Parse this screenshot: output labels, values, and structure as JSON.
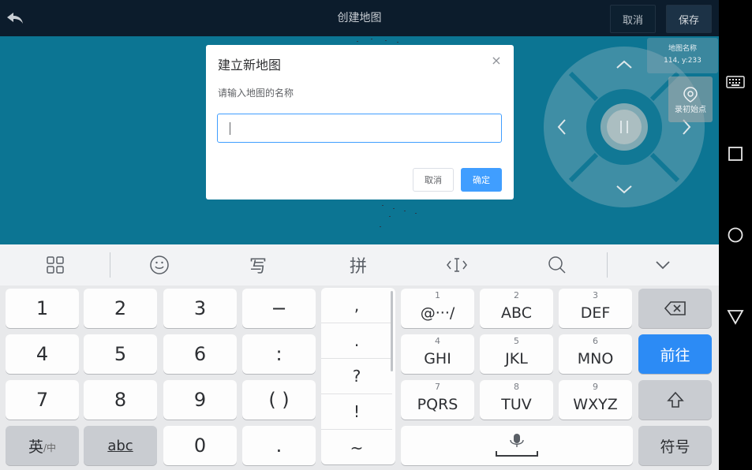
{
  "header": {
    "title": "创建地图",
    "cancel_label": "取消",
    "save_label": "保存"
  },
  "overlay": {
    "info_line1": "地图名称",
    "info_line2": "114, y:233",
    "record_label": "录初始点"
  },
  "dialog": {
    "title": "建立新地图",
    "prompt": "请输入地图的名称",
    "input_value": "",
    "cancel_label": "取消",
    "ok_label": "确定"
  },
  "keyboard": {
    "toolbar": [
      "grid-icon",
      "emoji-icon",
      "写",
      "拼",
      "cursor-icon",
      "search-icon",
      "collapse-icon"
    ],
    "keys": {
      "k1": "1",
      "k2": "2",
      "k3": "3",
      "kdash": "−",
      "k4": "4",
      "k5": "5",
      "k6": "6",
      "kcolon": ":",
      "k7": "7",
      "k8": "8",
      "k9": "9",
      "kparen": "( )",
      "lang_main": "英",
      "lang_sub": "/中",
      "abc": "abc",
      "k0": "0",
      "kdot": "."
    },
    "punctuation": [
      ",",
      ".",
      "?",
      "!",
      "~"
    ],
    "t9": [
      {
        "num": "1",
        "letters": "@···/"
      },
      {
        "num": "2",
        "letters": "ABC"
      },
      {
        "num": "3",
        "letters": "DEF"
      },
      {
        "num": "4",
        "letters": "GHI"
      },
      {
        "num": "5",
        "letters": "JKL"
      },
      {
        "num": "6",
        "letters": "MNO"
      },
      {
        "num": "7",
        "letters": "PQRS"
      },
      {
        "num": "8",
        "letters": "TUV"
      },
      {
        "num": "9",
        "letters": "WXYZ"
      }
    ],
    "go_label": "前往",
    "symbols_label": "符号"
  },
  "colors": {
    "accent": "#409eff",
    "map": "#0c7593",
    "keyboard_go": "#2c8bf5"
  }
}
